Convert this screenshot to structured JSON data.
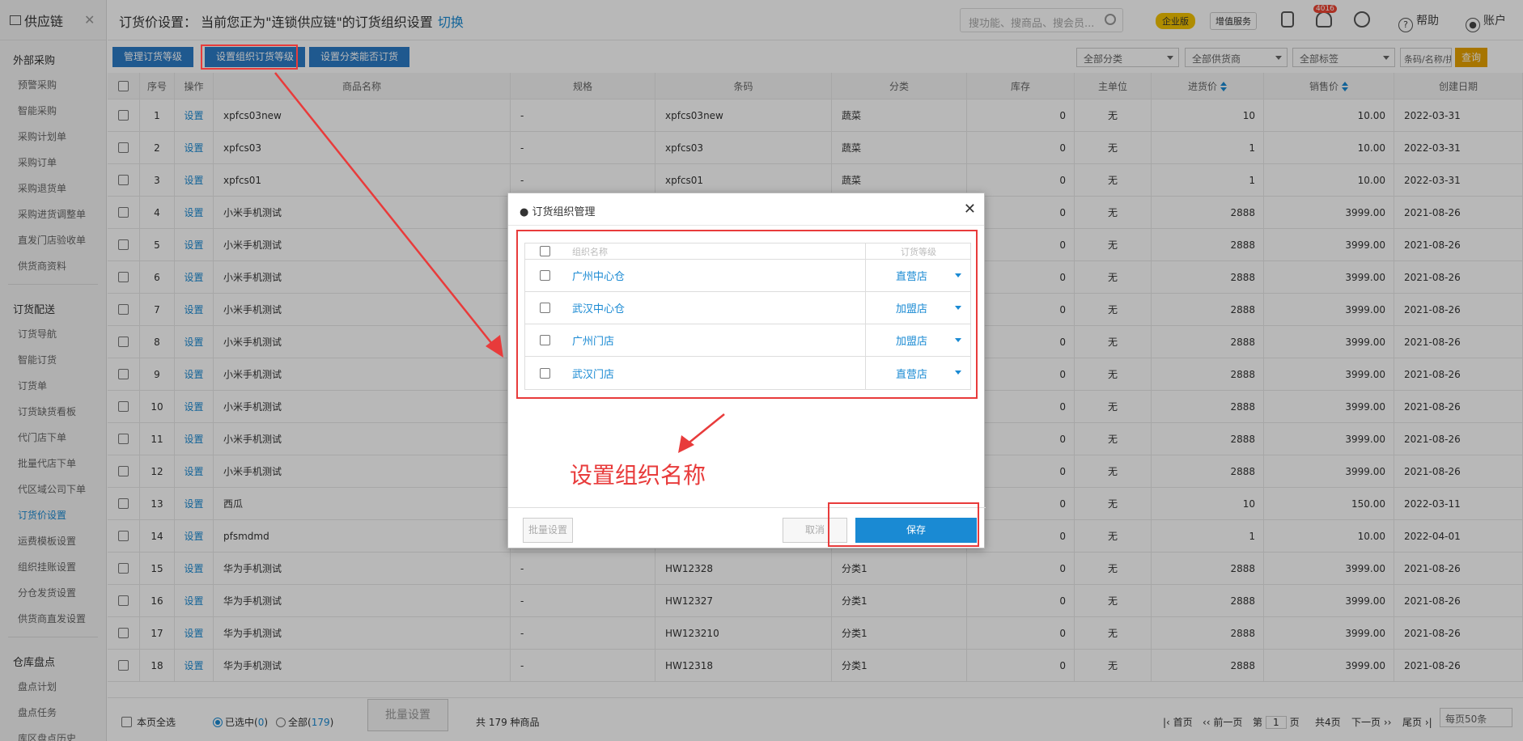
{
  "sidebar": {
    "app": "供应链",
    "groups": [
      {
        "title": "外部采购",
        "items": [
          "预警采购",
          "智能采购",
          "采购计划单",
          "采购订单",
          "采购退货单",
          "采购进货调整单",
          "直发门店验收单",
          "供货商资料"
        ]
      },
      {
        "title": "订货配送",
        "items": [
          "订货导航",
          "智能订货",
          "订货单",
          "订货缺货看板",
          "代门店下单",
          "批量代店下单",
          "代区域公司下单",
          "订货价设置",
          "运费模板设置",
          "组织挂账设置",
          "分仓发货设置",
          "供货商直发设置"
        ]
      },
      {
        "title": "仓库盘点",
        "items": [
          "盘点计划",
          "盘点任务",
          "库区盘点历史"
        ]
      }
    ],
    "active": "订货价设置"
  },
  "header": {
    "title": "订货价设置： 当前您正为\"连锁供应链\"的订货组织设置",
    "switch": "切换",
    "search_placeholder": "搜功能、搜商品、搜会员...",
    "enterprise": "企业版",
    "vas": "增值服务",
    "bell_count": "4016",
    "help": "帮助",
    "account": "账户"
  },
  "toolbar": {
    "btn1": "管理订货等级",
    "btn2": "设置组织订货等级",
    "btn3": "设置分类能否订货",
    "f1": "全部分类",
    "f2": "全部供货商",
    "f3": "全部标签",
    "f4": "条码/名称/拼音码",
    "query": "查询"
  },
  "table": {
    "headers": [
      "序号",
      "操作",
      "商品名称",
      "规格",
      "条码",
      "分类",
      "库存",
      "主单位",
      "进货价",
      "销售价",
      "创建日期"
    ],
    "op": "设置",
    "rows": [
      [
        "1",
        "xpfcs03new",
        "-",
        "xpfcs03new",
        "蔬菜",
        "0",
        "无",
        "10",
        "10.00",
        "2022-03-31"
      ],
      [
        "2",
        "xpfcs03",
        "-",
        "xpfcs03",
        "蔬菜",
        "0",
        "无",
        "1",
        "10.00",
        "2022-03-31"
      ],
      [
        "3",
        "xpfcs01",
        "-",
        "xpfcs01",
        "蔬菜",
        "0",
        "无",
        "1",
        "10.00",
        "2022-03-31"
      ],
      [
        "4",
        "小米手机测试",
        "",
        "",
        "",
        "0",
        "无",
        "2888",
        "3999.00",
        "2021-08-26"
      ],
      [
        "5",
        "小米手机测试",
        "",
        "",
        "",
        "0",
        "无",
        "2888",
        "3999.00",
        "2021-08-26"
      ],
      [
        "6",
        "小米手机测试",
        "",
        "",
        "",
        "0",
        "无",
        "2888",
        "3999.00",
        "2021-08-26"
      ],
      [
        "7",
        "小米手机测试",
        "",
        "",
        "",
        "0",
        "无",
        "2888",
        "3999.00",
        "2021-08-26"
      ],
      [
        "8",
        "小米手机测试",
        "",
        "",
        "",
        "0",
        "无",
        "2888",
        "3999.00",
        "2021-08-26"
      ],
      [
        "9",
        "小米手机测试",
        "",
        "",
        "",
        "0",
        "无",
        "2888",
        "3999.00",
        "2021-08-26"
      ],
      [
        "10",
        "小米手机测试",
        "",
        "",
        "",
        "0",
        "无",
        "2888",
        "3999.00",
        "2021-08-26"
      ],
      [
        "11",
        "小米手机测试",
        "",
        "",
        "",
        "0",
        "无",
        "2888",
        "3999.00",
        "2021-08-26"
      ],
      [
        "12",
        "小米手机测试",
        "",
        "",
        "",
        "0",
        "无",
        "2888",
        "3999.00",
        "2021-08-26"
      ],
      [
        "13",
        "西瓜",
        "",
        "",
        "",
        "0",
        "无",
        "10",
        "150.00",
        "2022-03-11"
      ],
      [
        "14",
        "pfsmdmd",
        "",
        "",
        "",
        "0",
        "无",
        "1",
        "10.00",
        "2022-04-01"
      ],
      [
        "15",
        "华为手机测试",
        "-",
        "HW12328",
        "分类1",
        "0",
        "无",
        "2888",
        "3999.00",
        "2021-08-26"
      ],
      [
        "16",
        "华为手机测试",
        "-",
        "HW12327",
        "分类1",
        "0",
        "无",
        "2888",
        "3999.00",
        "2021-08-26"
      ],
      [
        "17",
        "华为手机测试",
        "-",
        "HW123210",
        "分类1",
        "0",
        "无",
        "2888",
        "3999.00",
        "2021-08-26"
      ],
      [
        "18",
        "华为手机测试",
        "-",
        "HW12318",
        "分类1",
        "0",
        "无",
        "2888",
        "3999.00",
        "2021-08-26"
      ]
    ]
  },
  "footer": {
    "select_page": "本页全选",
    "selected": "已选中(",
    "selected_n": "0",
    "all": "全部(",
    "all_n": "179",
    "close": ")",
    "batch": "批量设置",
    "total": "共 179 种商品",
    "first": "首页",
    "prev": "前一页",
    "page_pre": "第",
    "page": "1",
    "page_post": "页",
    "pages": "共4页",
    "next": "下一页",
    "last": "尾页",
    "per_page": "每页50条"
  },
  "modal": {
    "title": "● 订货组织管理",
    "col_org": "组织名称",
    "col_level": "订货等级",
    "rows": [
      {
        "org": "广州中心仓",
        "level": "直营店"
      },
      {
        "org": "武汉中心仓",
        "level": "加盟店"
      },
      {
        "org": "广州门店",
        "level": "加盟店"
      },
      {
        "org": "武汉门店",
        "level": "直营店"
      }
    ],
    "batch": "批量设置",
    "cancel": "取消",
    "save": "保存"
  },
  "annotation": "设置组织名称",
  "colors": {
    "accent": "#1a8ad3",
    "annotation": "#e83b3b",
    "query": "#e8a200"
  }
}
